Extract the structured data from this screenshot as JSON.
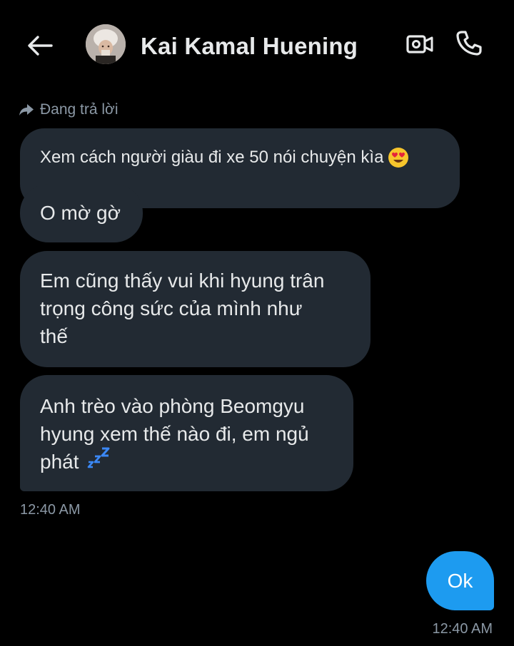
{
  "header": {
    "back_label": "Back",
    "contact_name": "Kai Kamal Huening",
    "video_call_icon": "video-camera-icon",
    "voice_call_icon": "phone-icon"
  },
  "conversation": {
    "reply_indicator": {
      "icon": "reply-arrow-icon",
      "text": "Đang trả lời"
    },
    "received": [
      {
        "text": "Xem cách người giàu đi xe 50 nói chuyện kìa",
        "emoji": "😍"
      },
      {
        "text": "O mờ gờ"
      },
      {
        "lines": [
          "Em cũng thấy vui khi hyung trân",
          "trọng công sức của mình như",
          "thế"
        ]
      },
      {
        "lines": [
          "Anh trèo vào phòng Beomgyu",
          "hyung xem thế nào đi, em ngủ",
          "phát"
        ],
        "emoji": "💤"
      }
    ],
    "received_time": "12:40 AM",
    "sent": [
      {
        "text": "Ok"
      }
    ],
    "sent_time": "12:40 AM"
  },
  "colors": {
    "background": "#000000",
    "received_bubble": "#222a33",
    "sent_bubble": "#1d9bf0",
    "text_primary": "#e7e9ea",
    "text_secondary": "#8b98a5"
  }
}
